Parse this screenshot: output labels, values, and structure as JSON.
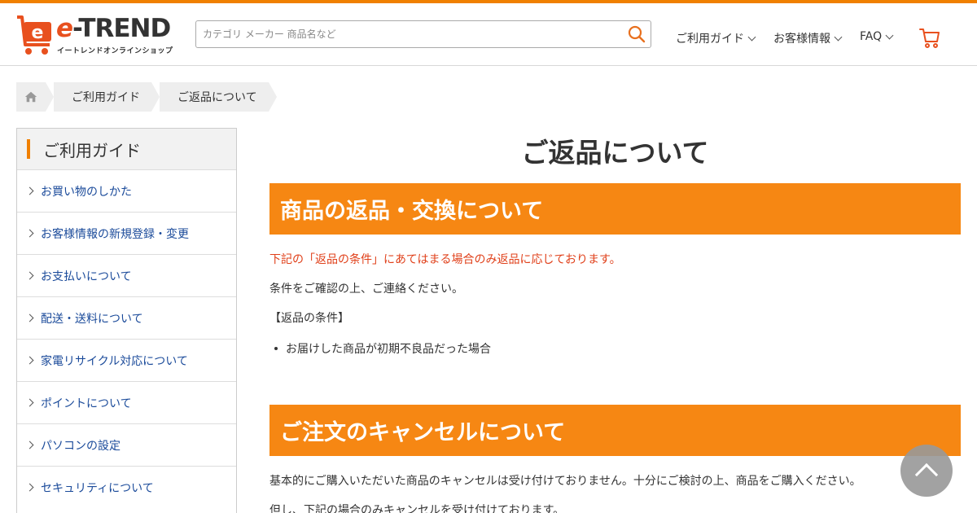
{
  "header": {
    "logo_main": "-TREND",
    "logo_e": "e",
    "logo_sub": "イートレンドオンラインショップ",
    "search_placeholder": "カテゴリ メーカー 商品名など",
    "nav": [
      {
        "label": "ご利用ガイド"
      },
      {
        "label": "お客様情報"
      },
      {
        "label": "FAQ"
      }
    ]
  },
  "breadcrumb": [
    "ご利用ガイド",
    "ご返品について"
  ],
  "sidebar": {
    "title": "ご利用ガイド",
    "items": [
      {
        "label": "お買い物のしかた"
      },
      {
        "label": "お客様情報の新規登録・変更"
      },
      {
        "label": "お支払いについて"
      },
      {
        "label": "配送・送料について"
      },
      {
        "label": "家電リサイクル対応について"
      },
      {
        "label": "ポイントについて"
      },
      {
        "label": "パソコンの設定"
      },
      {
        "label": "セキュリティについて"
      }
    ]
  },
  "main": {
    "title": "ご返品について",
    "section1": {
      "heading": "商品の返品・交換について",
      "notice": "下記の「返品の条件」にあてはまる場合のみ返品に応じております。",
      "text": "条件をご確認の上、ご連絡ください。",
      "cond_label": "【返品の条件】",
      "bullets": [
        "お届けした商品が初期不良品だった場合"
      ]
    },
    "section2": {
      "heading": "ご注文のキャンセルについて",
      "text1": "基本的にご購入いただいた商品のキャンセルは受け付けておりません。十分にご検討の上、商品をご購入ください。",
      "text2": "但し、下記の場合のみキャンセルを受け付けております。"
    }
  },
  "colors": {
    "accent": "#f68713",
    "brand_red": "#e8501e",
    "link": "#1a4a9a",
    "notice": "#e0401a"
  },
  "icons": {
    "search": "search-icon",
    "cart": "cart-icon",
    "home": "home-icon",
    "to_top": "chevron-up-icon"
  }
}
